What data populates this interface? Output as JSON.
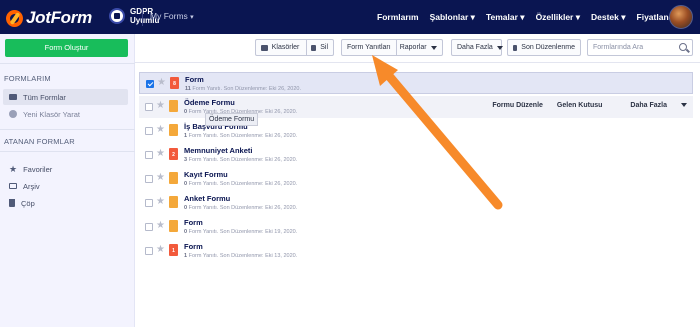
{
  "header": {
    "logo_text": "JotForm",
    "gdpr_line1": "GDPR",
    "gdpr_line2": "Uyumlu",
    "my_forms": "My Forms",
    "nav": [
      "Formlarım",
      "Şablonlar ▾",
      "Temalar ▾",
      "Özellikler ▾",
      "Destek ▾",
      "Fiyatlandırma"
    ]
  },
  "sidebar": {
    "create_button": "Form Oluştur",
    "section_forms": "FORMLARIM",
    "all_forms": "Tüm Formlar",
    "new_folder": "Yeni Klasör Yarat",
    "section_assigned": "ATANAN FORMLAR",
    "favorites": "Favoriler",
    "archive": "Arşiv",
    "trash": "Çöp"
  },
  "toolbar": {
    "folders": "Klasörler",
    "delete": "Sil",
    "form_responses": "Form Yanıtları",
    "reports": "Raporlar",
    "more": "Daha Fazla",
    "last_edited": "Son Düzenlenme",
    "search_placeholder": "Formlarında Ara"
  },
  "forms": [
    {
      "name": "Form",
      "count": "11",
      "meta_rest": " Form Yanıtı. Son Düzenlenme: Eki 26, 2020.",
      "badge": "8",
      "icon_color": "red"
    },
    {
      "name": "Ödeme Formu",
      "count": "0",
      "meta_rest": " Form Yanıtı. Son Düzenlenme: Eki 26, 2020.",
      "badge": "",
      "icon_color": "orange"
    },
    {
      "name": "İş Başvuru Formu",
      "count": "1",
      "meta_rest": " Form Yanıtı. Son Düzenlenme: Eki 26, 2020.",
      "badge": "",
      "icon_color": "orange"
    },
    {
      "name": "Memnuniyet Anketi",
      "count": "3",
      "meta_rest": " Form Yanıtı. Son Düzenlenme: Eki 26, 2020.",
      "badge": "2",
      "icon_color": "red"
    },
    {
      "name": "Kayıt Formu",
      "count": "0",
      "meta_rest": " Form Yanıtı. Son Düzenlenme: Eki 26, 2020.",
      "badge": "",
      "icon_color": "orange"
    },
    {
      "name": "Anket Formu",
      "count": "0",
      "meta_rest": " Form Yanıtı. Son Düzenlenme: Eki 26, 2020.",
      "badge": "",
      "icon_color": "orange"
    },
    {
      "name": "Form",
      "count": "0",
      "meta_rest": " Form Yanıtı. Son Düzenlenme: Eki 19, 2020.",
      "badge": "",
      "icon_color": "orange"
    },
    {
      "name": "Form",
      "count": "1",
      "meta_rest": " Form Yanıtı. Son Düzenlenme: Eki 13, 2020.",
      "badge": "1",
      "icon_color": "red"
    }
  ],
  "row_actions": {
    "edit": "Formu Düzenle",
    "inbox": "Gelen Kutusu",
    "more": "Daha Fazla"
  },
  "tooltip": "Ödeme Formu",
  "colors": {
    "header_bg": "#0a1551",
    "create_button": "#18bd5b",
    "annotation_arrow": "#f78a2a"
  }
}
